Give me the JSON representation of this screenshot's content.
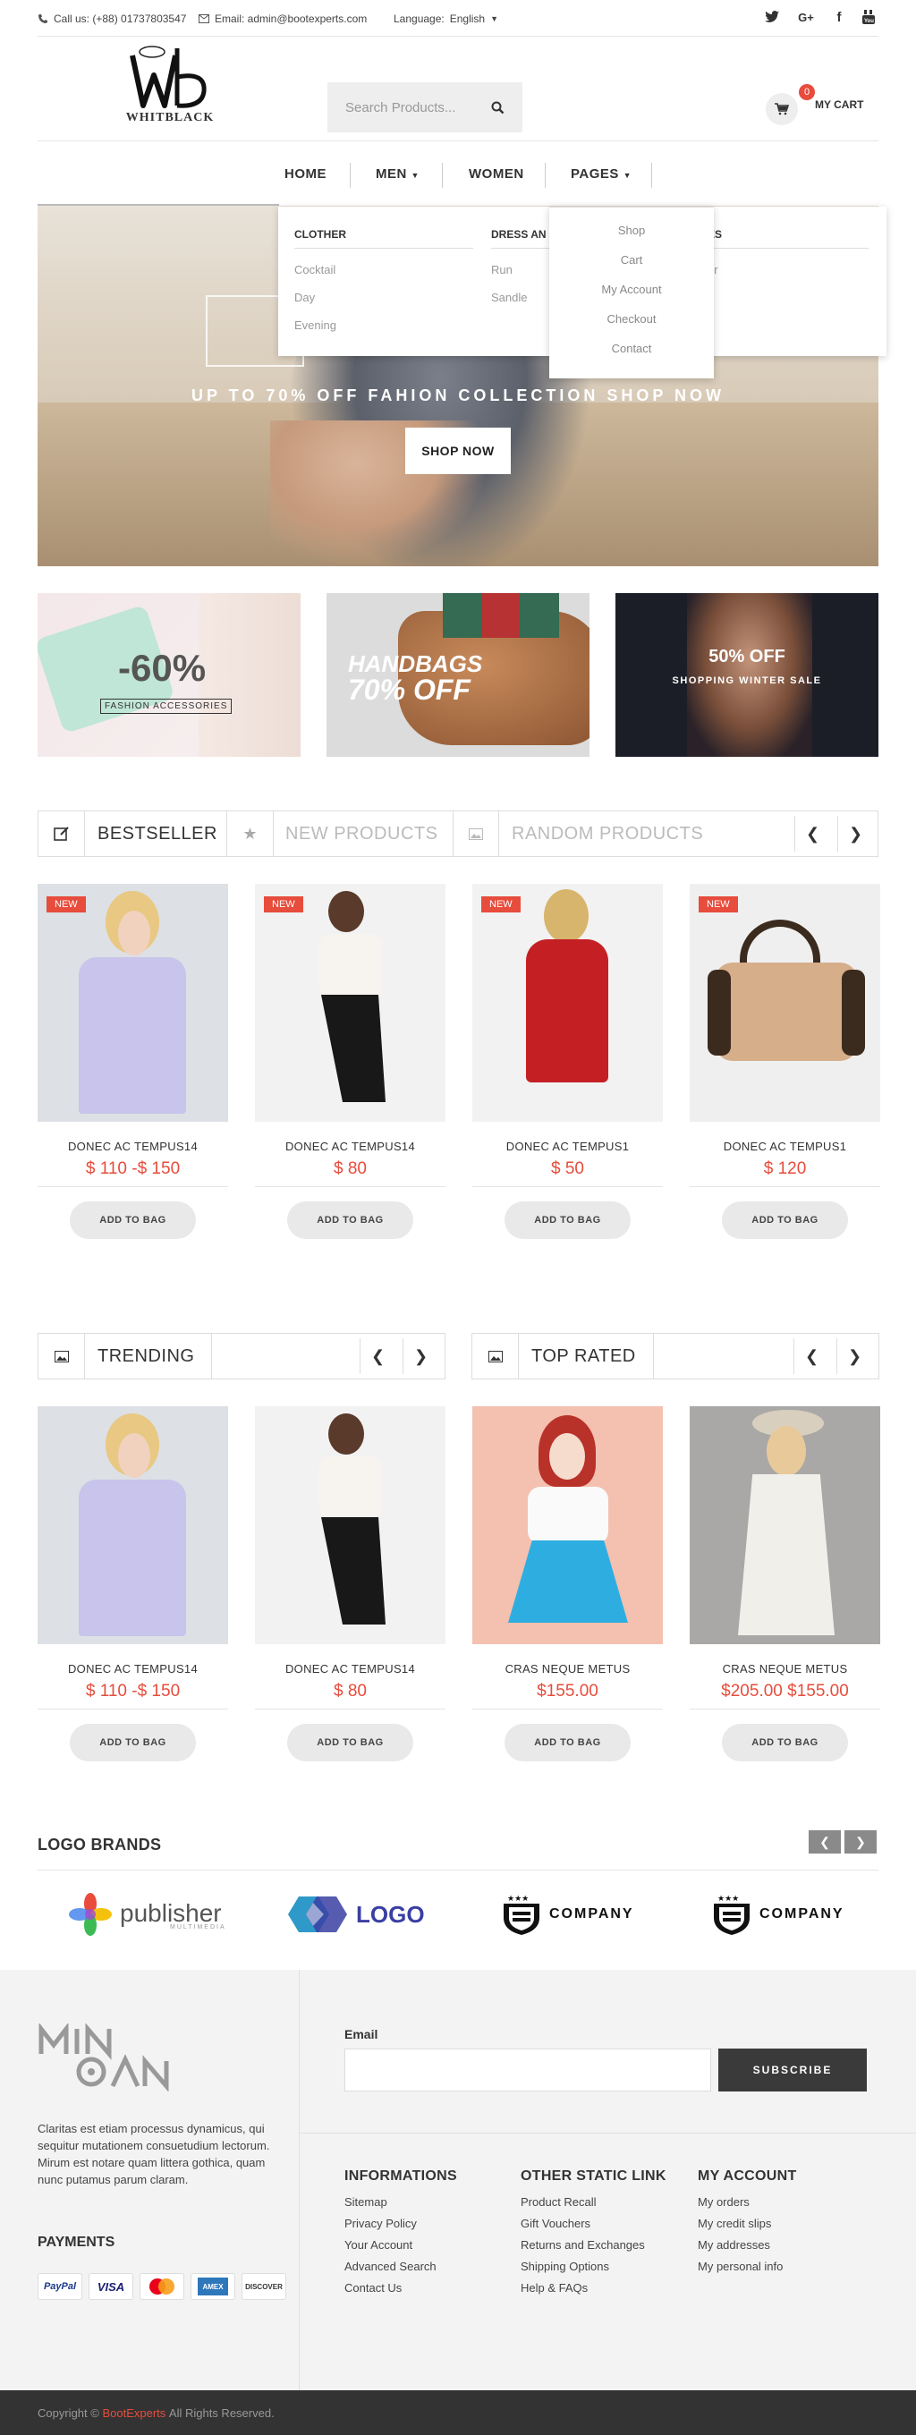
{
  "topbar": {
    "call": "Call us: (+88) 01737803547",
    "email": "Email: admin@bootexperts.com",
    "language_label": "Language:",
    "language_value": "English"
  },
  "social": [
    "twitter-icon",
    "google-plus-icon",
    "facebook-icon",
    "youtube-icon"
  ],
  "logo": {
    "brand": "WHITBLACK"
  },
  "search": {
    "placeholder": "Search Products..."
  },
  "cart": {
    "count": "0",
    "label": "MY CART"
  },
  "nav": {
    "home": "HOME",
    "men": "MEN",
    "women": "WOMEN",
    "pages": "PAGES"
  },
  "mega_menu": {
    "col1": {
      "heading": "CLOTHER",
      "links": [
        "Cocktail",
        "Day",
        "Evening"
      ]
    },
    "col2": {
      "heading": "DRESS AN",
      "links": [
        "Run",
        "Sandle"
      ]
    },
    "col3": {
      "heading": "ES",
      "links": [
        "er",
        "s",
        "e"
      ]
    }
  },
  "pages_dropdown": [
    "Shop",
    "Cart",
    "My Account",
    "Checkout",
    "Contact"
  ],
  "hero": {
    "text": "UP TO 70% OFF FAHION COLLECTION SHOP NOW",
    "button": "SHOP NOW"
  },
  "banners": {
    "b1": {
      "big": "-60%",
      "small": "FASHION ACCESSORIES"
    },
    "b2": {
      "big": "HANDBAGS",
      "small": "70% OFF"
    },
    "b3": {
      "big": "50% OFF",
      "small": "SHOPPING WINTER SALE"
    }
  },
  "tabs": {
    "t1": "BESTSELLER",
    "t2": "NEW PRODUCTS",
    "t3": "RANDOM PRODUCTS"
  },
  "products_row1": [
    {
      "badge": "NEW",
      "name": "DONEC AC TEMPUS14",
      "price": "$ 110 -$ 150",
      "button": "ADD TO BAG"
    },
    {
      "badge": "NEW",
      "name": "DONEC AC TEMPUS14",
      "price": "$ 80",
      "button": "ADD TO BAG"
    },
    {
      "badge": "NEW",
      "name": "DONEC AC TEMPUS1",
      "price": "$ 50",
      "button": "ADD TO BAG"
    },
    {
      "badge": "NEW",
      "name": "DONEC AC TEMPUS1",
      "price": "$ 120",
      "button": "ADD TO BAG"
    }
  ],
  "sections": {
    "trending": "TRENDING",
    "top_rated": "TOP RATED"
  },
  "products_row2": [
    {
      "name": "DONEC AC TEMPUS14",
      "price": "$ 110 -$ 150",
      "button": "ADD TO BAG"
    },
    {
      "name": "DONEC AC TEMPUS14",
      "price": "$ 80",
      "button": "ADD TO BAG"
    },
    {
      "name": "CRAS NEQUE METUS",
      "price": "$155.00",
      "button": "ADD TO BAG"
    },
    {
      "name": "CRAS NEQUE METUS",
      "price": "$205.00  $155.00",
      "button": "ADD TO BAG"
    }
  ],
  "brands": {
    "heading": "LOGO BRANDS",
    "b1": "publisher",
    "b1_sub": "MULTIMEDIA",
    "b2": "LOGO",
    "b3": "COMPANY",
    "b4": "COMPANY"
  },
  "footer": {
    "logo": "MINOAN",
    "about": "Claritas est etiam processus dynamicus, qui sequitur mutationem consuetudium lectorum. Mirum est notare quam littera gothica, quam nunc putamus parum claram.",
    "payments": "PAYMENTS",
    "pay_methods": [
      "PayPal",
      "VISA",
      "MC",
      "AMEX",
      "DISCOVER"
    ],
    "email_label": "Email",
    "subscribe": "SUBSCRIBE",
    "informations": {
      "heading": "INFORMATIONS",
      "links": [
        "Sitemap",
        "Privacy Policy",
        "Your Account",
        "Advanced Search",
        "Contact Us"
      ]
    },
    "static": {
      "heading": "OTHER STATIC LINK",
      "links": [
        "Product Recall",
        "Gift Vouchers",
        "Returns and Exchanges",
        "Shipping Options",
        "Help & FAQs"
      ]
    },
    "account": {
      "heading": "MY ACCOUNT",
      "links": [
        "My orders",
        "My credit slips",
        "My addresses",
        "My personal info"
      ]
    }
  },
  "copyright": {
    "prefix": "Copyright ©",
    "brand": "BootExperts",
    "suffix": "All Rights Reserved."
  }
}
